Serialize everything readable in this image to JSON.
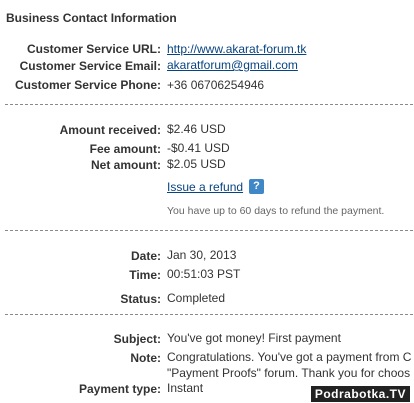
{
  "header": {
    "title": "Business Contact Information"
  },
  "contact": {
    "url_label": "Customer Service URL:",
    "url_value": "http://www.akarat-forum.tk",
    "email_label": "Customer Service Email:",
    "email_value": "akaratforum@gmail.com",
    "phone_label": "Customer Service Phone:",
    "phone_value": "+36 06706254946"
  },
  "amounts": {
    "received_label": "Amount received:",
    "received_value": "$2.46 USD",
    "fee_label": "Fee amount:",
    "fee_value": "-$0.41 USD",
    "net_label": "Net amount:",
    "net_value": "$2.05 USD",
    "refund_link": "Issue a refund",
    "help_icon": "?",
    "refund_note": "You have up to 60 days to refund the payment."
  },
  "transaction": {
    "date_label": "Date:",
    "date_value": "Jan 30, 2013",
    "time_label": "Time:",
    "time_value": "00:51:03 PST",
    "status_label": "Status:",
    "status_value": "Completed"
  },
  "details": {
    "subject_label": "Subject:",
    "subject_value": "You've got money! First payment",
    "note_label": "Note:",
    "note_line1": "Congratulations. You've got a payment from C",
    "note_line2": "\"Payment Proofs\" forum. Thank you for choos",
    "type_label": "Payment type:",
    "type_value": "Instant"
  },
  "watermark": "Podrabotka.TV",
  "colors": {
    "link": "#084482",
    "help_icon": "#3f87c7",
    "divider": "#8a8a8a"
  }
}
